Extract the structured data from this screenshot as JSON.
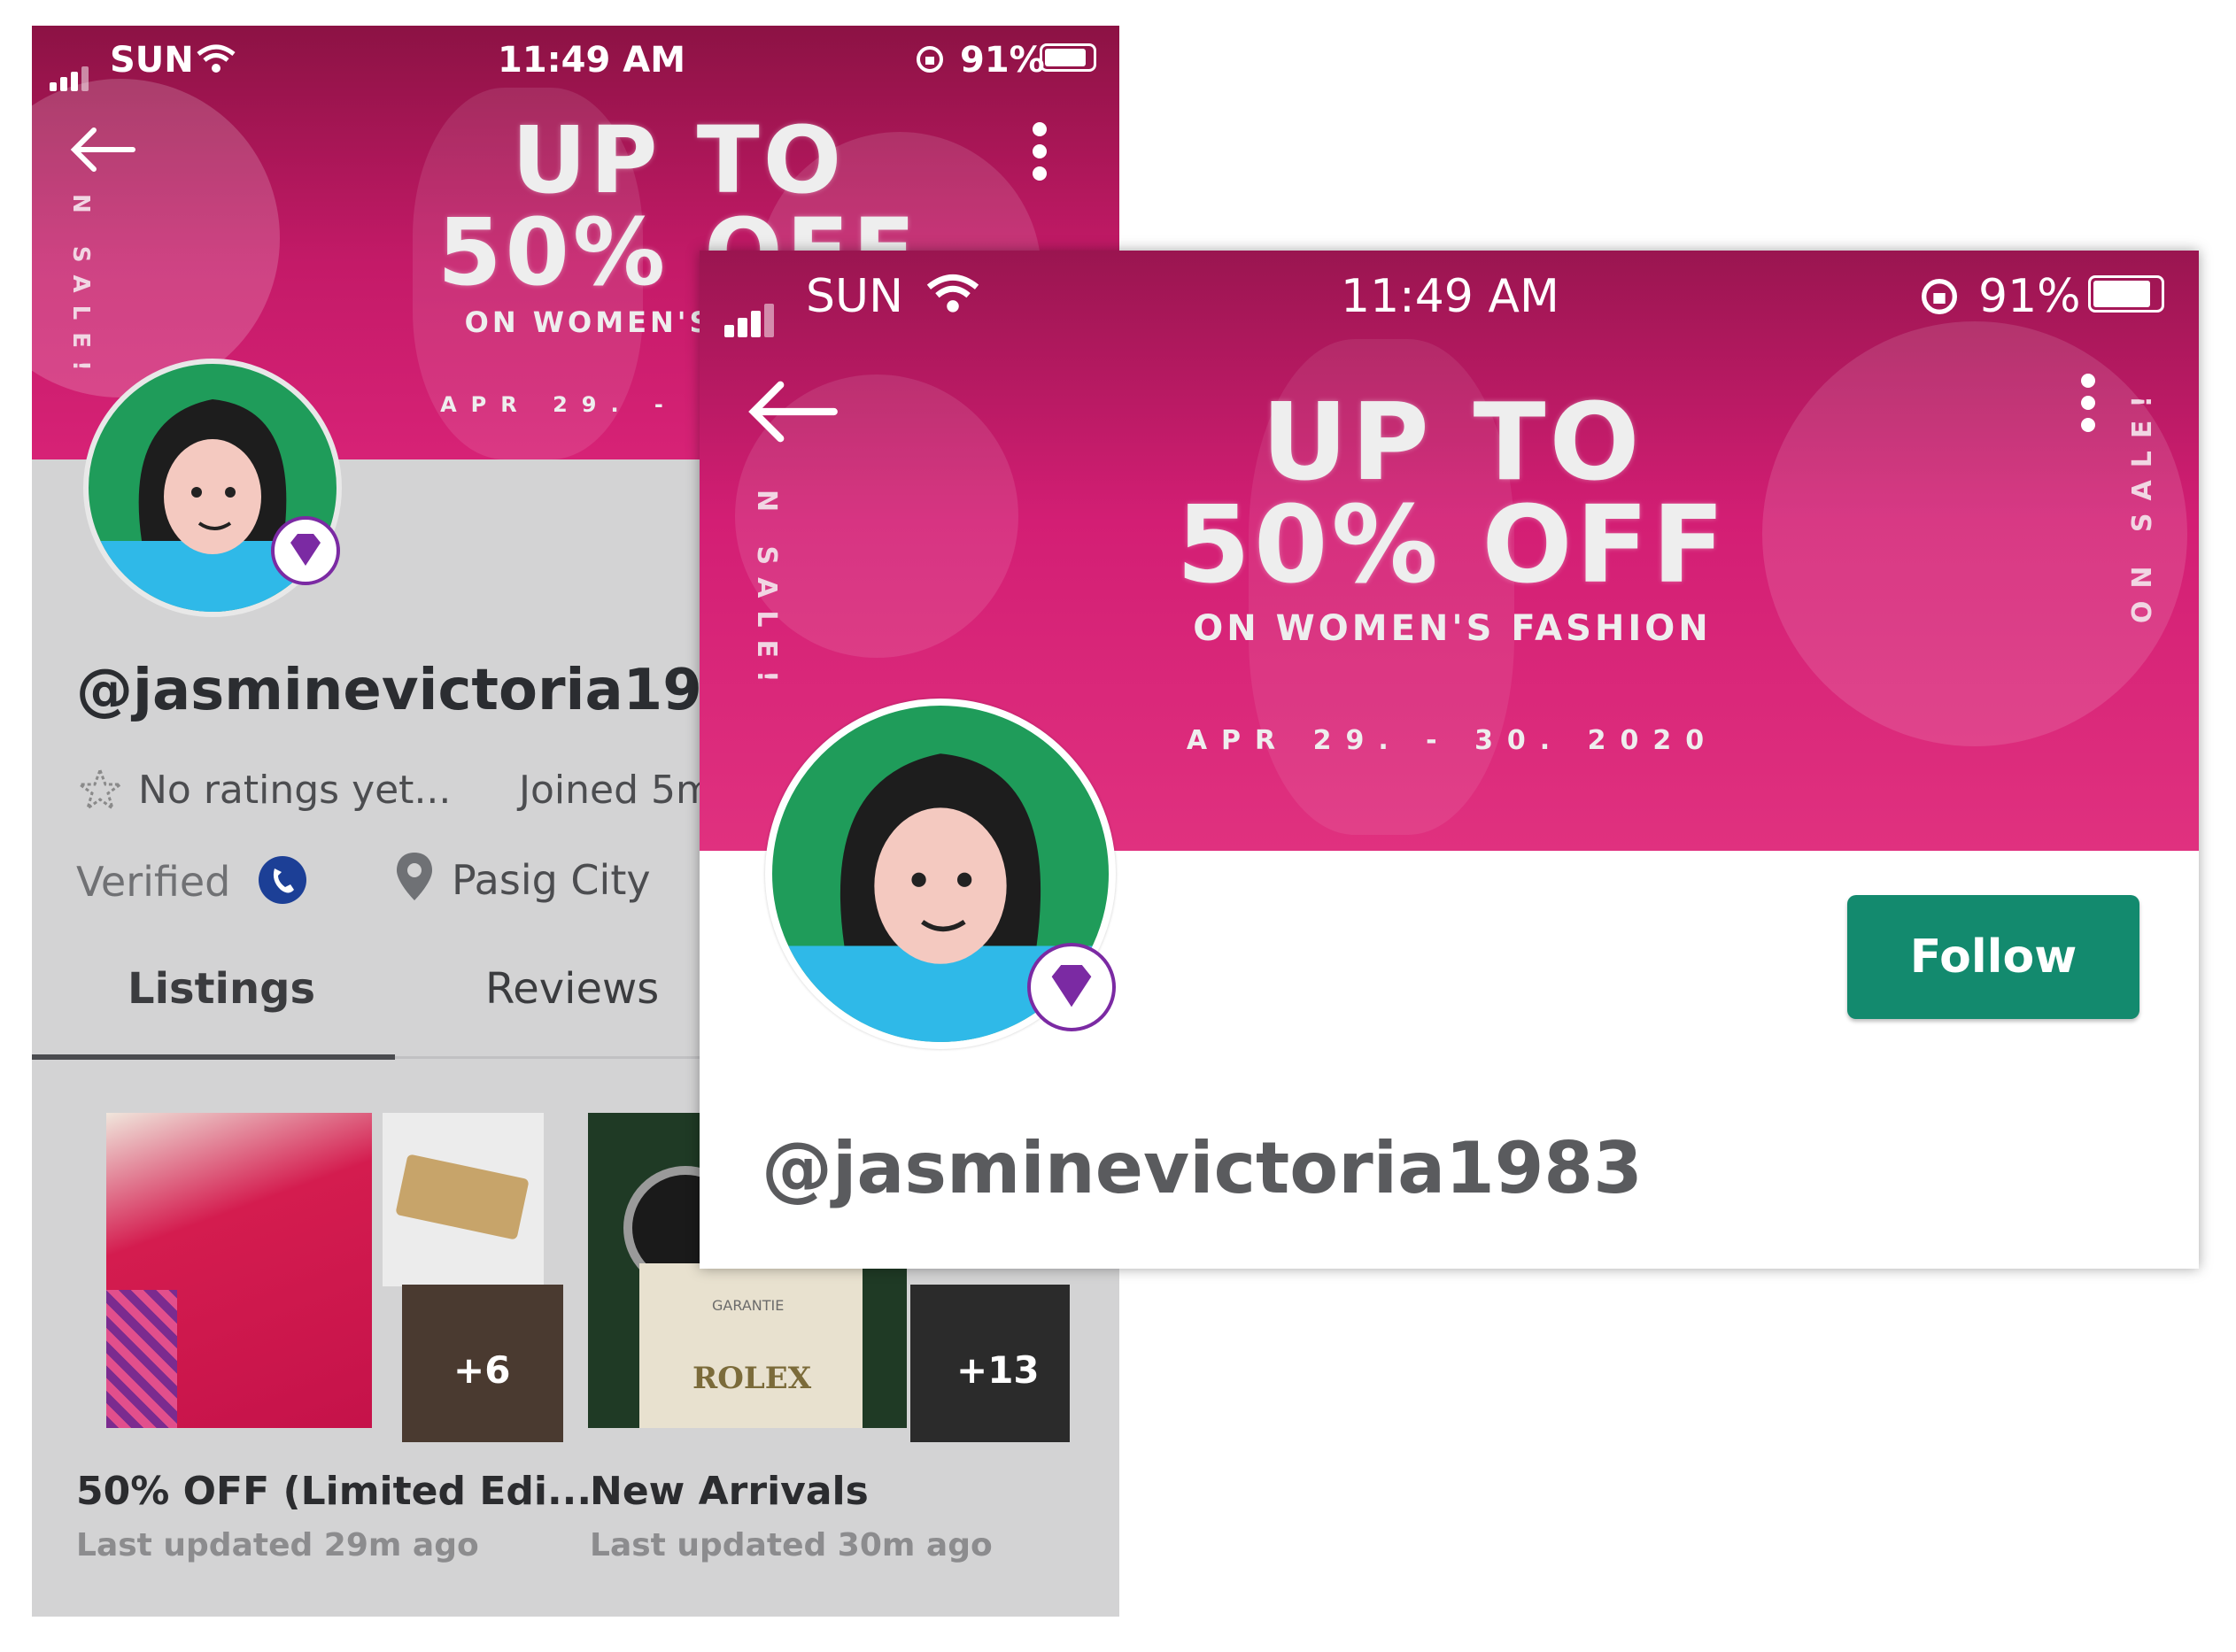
{
  "status_bar": {
    "carrier": "SUN",
    "time": "11:49 AM",
    "battery": "91%"
  },
  "banner": {
    "line1": "UP TO",
    "line2": "50% OFF",
    "line3": "ON WOMEN'S FASHION",
    "dates": "APR 29. - 30. 2020",
    "side_left": "N SALE!",
    "side_right": "ON SALE!"
  },
  "profile": {
    "username": "@jasminevictoria1983",
    "ratings": "No ratings yet...",
    "joined": "Joined 5m",
    "verified": "Verified",
    "location": "Pasig City",
    "follow_label": "Follow"
  },
  "tabs": [
    {
      "label": "Listings",
      "active": true
    },
    {
      "label": "Reviews",
      "active": false
    }
  ],
  "collections": [
    {
      "title": "50% OFF (Limited Edi...",
      "subtitle": "Last updated 29m ago",
      "more_count": "+6"
    },
    {
      "title": "New Arrivals",
      "subtitle": "Last updated 30m ago",
      "more_count": "+13",
      "brand_text": "ROLEX",
      "brand_subtext": "GARANTIE"
    }
  ],
  "colors": {
    "banner": "#d21f74",
    "follow": "#138a6e",
    "badge": "#7b2aa3",
    "phone_icon": "#1c3f96"
  },
  "icons": [
    "back-arrow-icon",
    "more-vert-icon",
    "star-icon",
    "phone-icon",
    "location-pin-icon",
    "diamond-icon",
    "wifi-icon",
    "signal-icon",
    "battery-icon",
    "rotation-lock-icon"
  ]
}
